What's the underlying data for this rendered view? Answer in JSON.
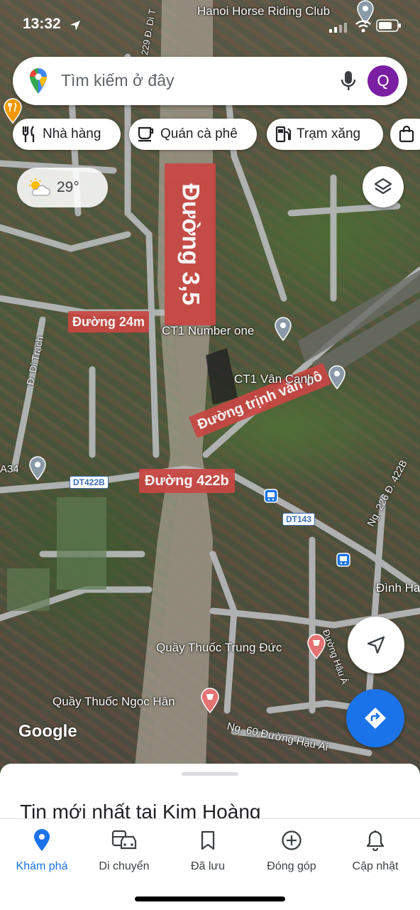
{
  "status_bar": {
    "time": "13:32"
  },
  "search": {
    "placeholder": "Tìm kiếm ở đây",
    "avatar_letter": "Q"
  },
  "chips": [
    {
      "label": "Nhà hàng",
      "icon": "restaurant-icon"
    },
    {
      "label": "Quán cà phê",
      "icon": "coffee-icon"
    },
    {
      "label": "Trạm xăng",
      "icon": "gas-station-icon"
    },
    {
      "label": "",
      "icon": "shopping-bag-icon"
    }
  ],
  "weather": {
    "temperature": "29°",
    "icon": "partly-cloudy-icon"
  },
  "map": {
    "place_labels": {
      "horse_club": "Hanoi Horse Riding Club",
      "ct1_number_one": "CT1 Number one",
      "ct1_van_canh": "CT1 Vân Canh",
      "dinh": "Đình Ha",
      "quay_thuoc_trung_duc": "Quầy Thuốc Trung Đức",
      "quay_thuoc_ngoc_han": "Quầy Thuốc Ngọc Hân",
      "a34": "A34"
    },
    "street_labels": {
      "di_trach": "Đ. Di Trạch",
      "d229": "229 Đ. Di T",
      "ng226": "Ng. 226 Đ. 422B",
      "ng60": "Ng. 60 Đường Hậu Ái",
      "duong_partial": "Đường Hậu Ái"
    },
    "route_shields": {
      "dt422b": "DT422B",
      "dt143": "DT143"
    },
    "road_annotations": {
      "duong35": "Đường 3,5",
      "duong24m": "Đường 24m",
      "trinh_van_bo": "Đường trịnh văn bô",
      "duong422b": "Đường 422b"
    },
    "attribution": "Google"
  },
  "bottom_sheet": {
    "title": "Tin mới nhất tại Kim Hoàng"
  },
  "nav": [
    {
      "label": "Khám phá",
      "icon": "explore-pin-icon",
      "active": true
    },
    {
      "label": "Di chuyển",
      "icon": "commute-icon",
      "active": false
    },
    {
      "label": "Đã lưu",
      "icon": "bookmark-icon",
      "active": false
    },
    {
      "label": "Đóng góp",
      "icon": "add-circle-icon",
      "active": false
    },
    {
      "label": "Cập nhật",
      "icon": "bell-icon",
      "active": false
    }
  ],
  "colors": {
    "accent": "#1a73e8",
    "avatar": "#7b1fa2",
    "annotation_red": "#c94743",
    "pin_gray": "#8a9aa8"
  }
}
